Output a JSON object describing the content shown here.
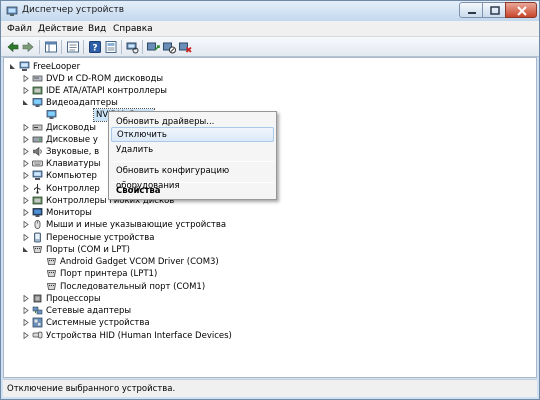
{
  "window": {
    "title": "Диспетчер устройств",
    "icon": "device-manager-icon"
  },
  "menubar": {
    "items": [
      "Файл",
      "Действие",
      "Вид",
      "Справка"
    ]
  },
  "toolbar": {
    "buttons": [
      "back-icon",
      "forward-icon",
      "show-hide-tree-icon",
      "properties-icon",
      "help-icon",
      "properties-sheet-icon",
      "scan-hardware-icon",
      "update-driver-icon",
      "disable-device-icon",
      "uninstall-device-icon"
    ]
  },
  "tree": {
    "root": "FreeLooper",
    "categories": [
      {
        "label": "DVD и CD-ROM дисководы",
        "expanded": false
      },
      {
        "label": "IDE ATA/ATAPI контроллеры",
        "expanded": false
      },
      {
        "label": "Видеоадаптеры",
        "expanded": true,
        "children": [
          "NVIDIA G"
        ]
      },
      {
        "label": "Дисководы",
        "expanded": false
      },
      {
        "label": "Дисковые у",
        "expanded": false
      },
      {
        "label": "Звуковые, в",
        "expanded": false
      },
      {
        "label": "Клавиатуры",
        "expanded": false
      },
      {
        "label": "Компьютер",
        "expanded": false
      },
      {
        "label": "Контроллер",
        "expanded": false
      },
      {
        "label": "Контроллеры гибких дисков",
        "expanded": false
      },
      {
        "label": "Мониторы",
        "expanded": false
      },
      {
        "label": "Мыши и иные указывающие устройства",
        "expanded": false
      },
      {
        "label": "Переносные устройства",
        "expanded": false
      },
      {
        "label": "Порты (COM и LPT)",
        "expanded": true,
        "children": [
          "Android Gadget VCOM Driver (COM3)",
          "Порт принтера (LPT1)",
          "Последовательный порт (COM1)"
        ]
      },
      {
        "label": "Процессоры",
        "expanded": false
      },
      {
        "label": "Сетевые адаптеры",
        "expanded": false
      },
      {
        "label": "Системные устройства",
        "expanded": false
      },
      {
        "label": "Устройства HID (Human Interface Devices)",
        "expanded": false
      }
    ]
  },
  "context_menu": {
    "items": [
      {
        "label": "Обновить драйверы...",
        "highlighted": false
      },
      {
        "label": "Отключить",
        "highlighted": true
      },
      {
        "label": "Удалить",
        "highlighted": false
      },
      {
        "label": "Обновить конфигурацию оборудования",
        "highlighted": false
      },
      {
        "label": "Свойства",
        "bold": true
      }
    ]
  },
  "statusbar": {
    "text": "Отключение выбранного устройства."
  },
  "colors": {
    "frame": "#cfe1f3",
    "selection": "#cce4f7",
    "menu_highlight": "#dbe9f8",
    "close_button": "#c9452a"
  }
}
